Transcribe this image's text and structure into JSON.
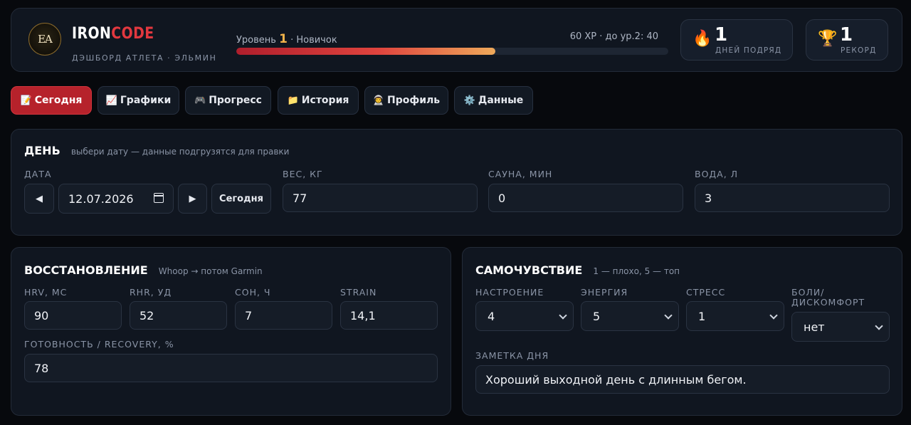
{
  "header": {
    "logo_text": "EA",
    "brand_white": "IRON",
    "brand_red": "CODE",
    "subtitle": "ДЭШБОРД АТЛЕТА · ЭЛЬМИН",
    "level_prefix": "Уровень",
    "level_num": "1",
    "level_suffix": "· Новичок",
    "xp_text": "60 XP · до ур.2: 40",
    "xp_progress_pct": 60,
    "streak": {
      "icon": "🔥",
      "value": "1",
      "label": "ДНЕЙ ПОДРЯД"
    },
    "record": {
      "icon": "🏆",
      "value": "1",
      "label": "РЕКОРД"
    }
  },
  "tabs": [
    {
      "icon": "📝",
      "label": "Сегодня",
      "active": true
    },
    {
      "icon": "📈",
      "label": "Графики",
      "active": false
    },
    {
      "icon": "🎮",
      "label": "Прогресс",
      "active": false
    },
    {
      "icon": "📁",
      "label": "История",
      "active": false
    },
    {
      "icon": "👨‍🚀",
      "label": "Профиль",
      "active": false
    },
    {
      "icon": "⚙️",
      "label": "Данные",
      "active": false
    }
  ],
  "day": {
    "title": "ДЕНЬ",
    "hint": "выбери дату — данные подгрузятся для правки",
    "date_label": "ДАТА",
    "date_value": "12.07.2026",
    "prev": "◀",
    "next": "▶",
    "today_btn": "Сегодня",
    "weight_label": "ВЕС, КГ",
    "weight_value": "77",
    "sauna_label": "САУНА, МИН",
    "sauna_value": "0",
    "water_label": "ВОДА, Л",
    "water_value": "3"
  },
  "recovery": {
    "title": "ВОССТАНОВЛЕНИЕ",
    "hint": "Whoop → потом Garmin",
    "hrv_label": "HRV, МС",
    "hrv_value": "90",
    "rhr_label": "RHR, УД",
    "rhr_value": "52",
    "sleep_label": "СОН, Ч",
    "sleep_value": "7",
    "strain_label": "STRAIN",
    "strain_value": "14,1",
    "ready_label": "ГОТОВНОСТЬ / RECOVERY, %",
    "ready_value": "78"
  },
  "feeling": {
    "title": "САМОЧУВСТВИЕ",
    "hint": "1 — плохо, 5 — топ",
    "mood_label": "НАСТРОЕНИЕ",
    "mood_value": "4",
    "energy_label": "ЭНЕРГИЯ",
    "energy_value": "5",
    "stress_label": "СТРЕСС",
    "stress_value": "1",
    "pain_label_1": "БОЛИ/",
    "pain_label_2": "ДИСКОМФОРТ",
    "pain_value": "нет",
    "note_label": "ЗАМЕТКА ДНЯ",
    "note_value": "Хороший выходной день с длинным бегом."
  }
}
